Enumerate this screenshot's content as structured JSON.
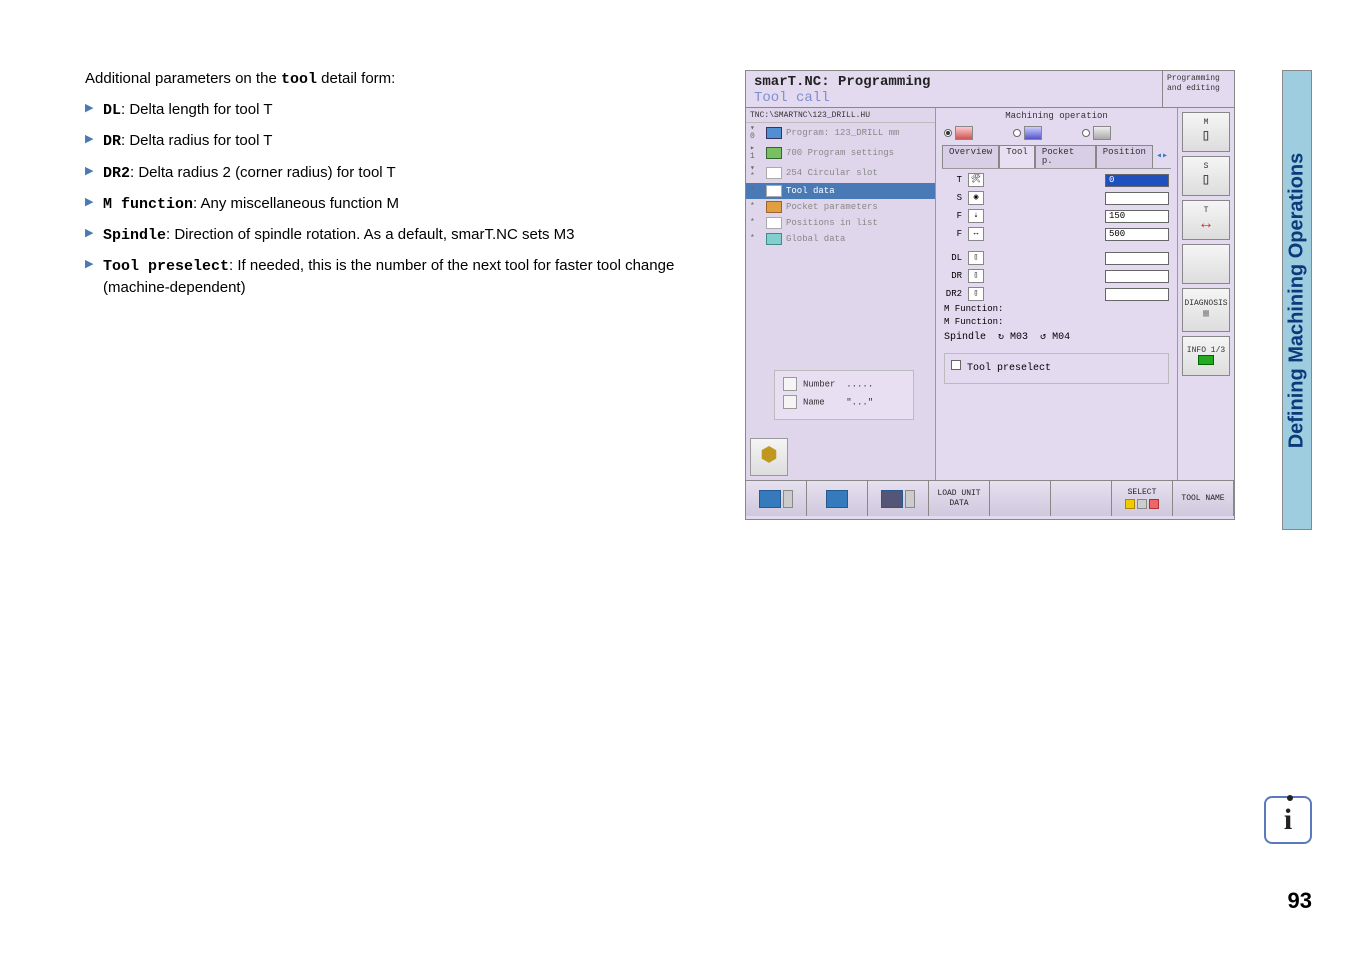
{
  "intro": {
    "prefix": "Additional parameters on the ",
    "bold": "tool",
    "suffix": " detail form:"
  },
  "bullets": [
    {
      "term": "DL",
      "desc": ": Delta length for tool T"
    },
    {
      "term": "DR",
      "desc": ": Delta radius for tool T"
    },
    {
      "term": "DR2",
      "desc": ": Delta radius 2 (corner radius) for tool T"
    },
    {
      "term": "M function",
      "desc": ": Any miscellaneous function M"
    },
    {
      "term": "Spindle",
      "desc": ": Direction of spindle rotation. As a default, smarT.NC sets M3"
    },
    {
      "term": "Tool preselect",
      "desc": ": If needed, this is the number of the next tool for faster tool change (machine-dependent)"
    }
  ],
  "screenshot": {
    "title1": "smarT.NC: Programming",
    "title2": "Tool call",
    "mode": "Programming and editing",
    "path": "TNC:\\SMARTNC\\123_DRILL.HU",
    "tree": [
      {
        "marker": "▾ 0",
        "iconclass": "blue",
        "label": "Program: 123_DRILL mm",
        "selected": false
      },
      {
        "marker": "▸ 1",
        "iconclass": "green",
        "label": "700 Program settings",
        "selected": false
      },
      {
        "marker": "▾ *",
        "iconclass": "white",
        "label": "254 Circular slot",
        "selected": false
      },
      {
        "marker": "  *",
        "iconclass": "white",
        "label": "Tool data",
        "selected": true
      },
      {
        "marker": "  *",
        "iconclass": "orange",
        "label": "Pocket parameters",
        "selected": false
      },
      {
        "marker": "  *",
        "iconclass": "white",
        "label": "Positions in list",
        "selected": false
      },
      {
        "marker": "  *",
        "iconclass": "aqua",
        "label": "Global data",
        "selected": false
      }
    ],
    "infobox": {
      "number_lbl": "Number",
      "number_val": ".....",
      "name_lbl": "Name",
      "name_val": "\"...\""
    },
    "form_title": "Machining operation",
    "tabs": [
      "Overview",
      "Tool",
      "Pocket p.",
      "Position"
    ],
    "active_tab": 1,
    "t_label": "T",
    "t_value": "0",
    "s_label": "S",
    "s_value": "",
    "f_label": "F",
    "f_value": "150",
    "f2_label": "F",
    "f2_value": "500",
    "dl_label": "DL",
    "dr_label": "DR",
    "dr2_label": "DR2",
    "mfunc1": "M Function:",
    "mfunc2": "M Function:",
    "spindle_label": "Spindle",
    "m03": "M03",
    "m04": "M04",
    "tool_presel_label": "Tool preselect",
    "sidebar": {
      "m_label": "M",
      "s_label": "S",
      "t_label": "T",
      "diag_label": "DIAGNOSIS",
      "info_label": "INFO 1/3"
    },
    "softkeys": {
      "load": "LOAD UNIT DATA",
      "select": "SELECT",
      "toolname": "TOOL NAME"
    }
  },
  "side_heading": "Defining Machining Operations",
  "page_number": "93"
}
